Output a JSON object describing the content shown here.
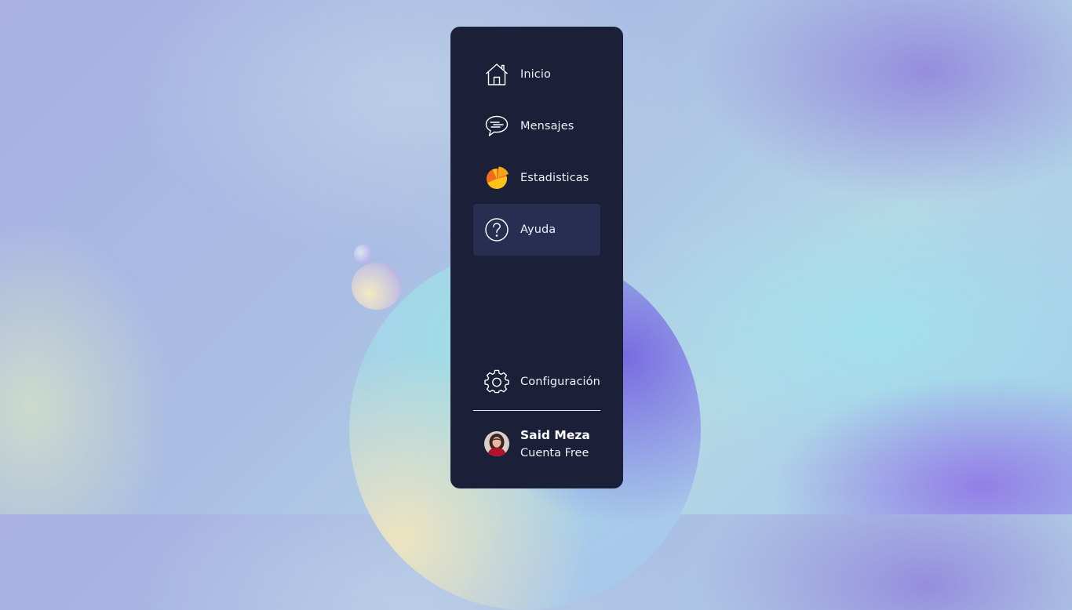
{
  "sidebar": {
    "items": [
      {
        "label": "Inicio",
        "icon": "home-icon",
        "active": false
      },
      {
        "label": "Mensajes",
        "icon": "chat-bubble-icon",
        "active": false
      },
      {
        "label": "Estadisticas",
        "icon": "pie-chart-icon",
        "active": false
      },
      {
        "label": "Ayuda",
        "icon": "help-circle-icon",
        "active": true
      }
    ],
    "settings": {
      "label": "Configuración",
      "icon": "gear-icon"
    },
    "user": {
      "name": "Said Meza",
      "plan": "Cuenta Free"
    }
  },
  "colors": {
    "sidebar_bg": "#1b1f38",
    "active_item_bg": "#272e52",
    "pie_orange": "#f26a1b",
    "pie_yellow": "#ffc21a"
  }
}
